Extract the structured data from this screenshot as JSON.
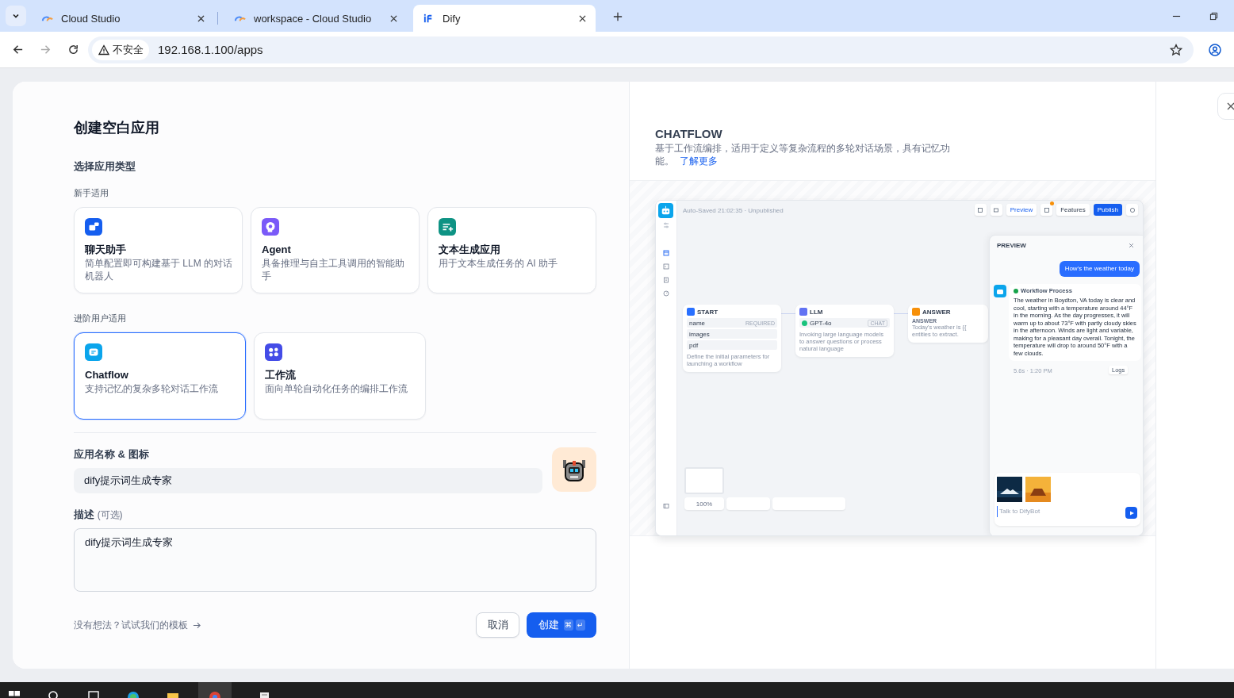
{
  "browser": {
    "tabs": [
      {
        "title": "Cloud Studio",
        "kind": "cloud",
        "selected": false
      },
      {
        "title": "workspace - Cloud Studio",
        "kind": "cloud",
        "selected": false
      },
      {
        "title": "Dify",
        "kind": "dify",
        "selected": true
      }
    ],
    "security_label": "不安全",
    "url": "192.168.1.100/apps"
  },
  "dialog": {
    "title": "创建空白应用",
    "type_heading": "选择应用类型",
    "groups": [
      {
        "label": "新手适用",
        "types": [
          {
            "kind": "chatbot",
            "name": "聊天助手",
            "description": "简单配置即可构建基于 LLM 的对话机器人",
            "color": "#155eef",
            "selected": false
          },
          {
            "kind": "agent",
            "name": "Agent",
            "description": "具备推理与自主工具调用的智能助手",
            "color": "#7a5af8",
            "selected": false
          },
          {
            "kind": "completion",
            "name": "文本生成应用",
            "description": "用于文本生成任务的 AI 助手",
            "color": "#0e9384",
            "selected": false
          }
        ]
      },
      {
        "label": "进阶用户适用",
        "types": [
          {
            "kind": "chatflow",
            "name": "Chatflow",
            "description": "支持记忆的复杂多轮对话工作流",
            "color": "#0ba5ec",
            "selected": true
          },
          {
            "kind": "workflow",
            "name": "工作流",
            "description": "面向单轮自动化任务的编排工作流",
            "color": "#444ce7",
            "selected": false
          }
        ]
      }
    ],
    "name_label": "应用名称 & 图标",
    "name_value": "dify提示词生成专家",
    "description_label": "描述",
    "description_hint": "(可选)",
    "description_value": "dify提示词生成专家",
    "template_link": "没有想法？试试我们的模板",
    "cancel": "取消",
    "create": "创建",
    "shortcut_keys": [
      "⌘",
      "↵"
    ]
  },
  "preview": {
    "title": "CHATFLOW",
    "description": "基于工作流编排，适用于定义等复杂流程的多轮对话场景，具有记忆功能。",
    "learn_more": "了解更多",
    "workflow": {
      "status": "Auto-Saved 21:02:35 · Unpublished",
      "toolbar": [
        {
          "label": "Preview",
          "kind": "outline"
        },
        {
          "label": "Features",
          "kind": "plain"
        },
        {
          "label": "Publish",
          "kind": "primary"
        }
      ],
      "nodes": [
        {
          "kind": "start",
          "title": "START",
          "fields": [
            {
              "name": "name",
              "tag": "REQUIRED"
            },
            {
              "name": "images"
            },
            {
              "name": "pdf"
            }
          ],
          "note": "Define the initial parameters for launching a workflow"
        },
        {
          "kind": "llm",
          "title": "LLM",
          "model": "GPT-4o",
          "tag": "CHAT",
          "note": "Invoking large language models to answer questions or process natural language"
        },
        {
          "kind": "answer",
          "title": "ANSWER",
          "label": "ANSWER",
          "note_lines": [
            "Today's weather is {{",
            "entities to extract."
          ]
        }
      ],
      "zoom": "100%",
      "chat": {
        "title": "PREVIEW",
        "question": "How's the weather today",
        "process": "Workflow Process",
        "answer": "The weather in Boydton, VA today is clear and cool, starting with a temperature around 44°F in the morning. As the day progresses, it will warm up to about 73°F with partly cloudy skies in the afternoon. Winds are light and variable, making for a pleasant day overall. Tonight, the temperature will drop to around 50°F with a few clouds.",
        "meta": "5.6s · 1:20 PM",
        "logs": "Logs",
        "placeholder": "Talk to DifyBot"
      }
    }
  }
}
